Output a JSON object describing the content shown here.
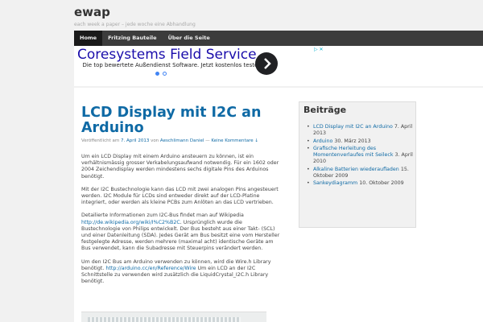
{
  "site": {
    "title": "ewap",
    "description": "each week a paper – jede woche eine Abhandlung"
  },
  "nav": [
    {
      "label": "Home"
    },
    {
      "label": "Fritzing Bauteile"
    },
    {
      "label": "Über die Seite"
    }
  ],
  "ad": {
    "headline": "Coresystems Field Service",
    "subline": "Die top bewertete Außendienst Software. Jetzt kostenlos testen!",
    "arrow_icon": "chevron-right-icon",
    "corner_icons": "▷ ✕",
    "dots": [
      true,
      false
    ]
  },
  "post": {
    "title": "LCD Display mit I2C an Arduino",
    "meta": {
      "published_prefix": "Veröffentlicht am",
      "date": "7. April 2013",
      "by_label": "von",
      "author": "Aeschlimann Daniel",
      "separator": "—",
      "comments": "Keine Kommentare ↓"
    },
    "paragraphs": [
      {
        "text": "Um ein LCD Display mit einem Arduino ansteuern zu können, ist ein verhältnismässig grosser Verkabelungsaufwand notwendig. Für ein 1602 oder 2004 Zeichendisplay werden mindestens sechs digitale Pins des Arduinos benötigt."
      },
      {
        "text": "Mit der I2C Bustechnologie kann das LCD mit zwei analogen Pins angesteuert werden. I2C Module für LCDs sind entweder direkt auf der LCD-Platine integriert, oder werden als kleine PCBs zum Anlöten an das LCD vertrieben."
      },
      {
        "before": "Detailierte Informationen zum I2C-Bus findet man auf Wikipedia",
        "link": "http://de.wikipedia.org/wiki/I%C2%B2C",
        "after": ". Ursprünglich wurde die Bustechnologie von Philips entwickelt. Der Bus besteht aus einer Takt- (SCL) und einer Datenleitung (SDA). Jedes Gerät am Bus besitzt eine vom Hersteller festgelegte Adresse, werden mehrere (maximal acht) identische Geräte am Bus verwendet, kann die Subadresse mit Steuerpins verändert werden."
      },
      {
        "before": "Um den I2C Bus am Arduino verwenden zu können, wird die Wire.h Library benötigt.",
        "link": "http://arduino.cc/en/Reference/Wire",
        "after": " Um ein LCD an der I2C Schnittstelle zu verwenden wird zusätzlich die LiquidCrystal_I2C.h Library benötigt."
      }
    ]
  },
  "sidebar": {
    "title": "Beiträge",
    "items": [
      {
        "link": "LCD Display mit I2C an Arduino",
        "date": "7. April 2013"
      },
      {
        "link": "Arduino",
        "date": "30. März 2013"
      },
      {
        "link": "Grafische Herleitung des Momentenverlaufes mit Seileck",
        "date": "3. April 2010"
      },
      {
        "link": "Alkaline Batterien wiederaufladen",
        "date": "15. Oktober 2009"
      },
      {
        "link": "Sankeydiagramm",
        "date": "10. Oktober 2009"
      }
    ]
  },
  "colors": {
    "link": "#0f6aa5",
    "nav_bg": "#3c3c3c",
    "ad_headline": "#1a0dab"
  }
}
